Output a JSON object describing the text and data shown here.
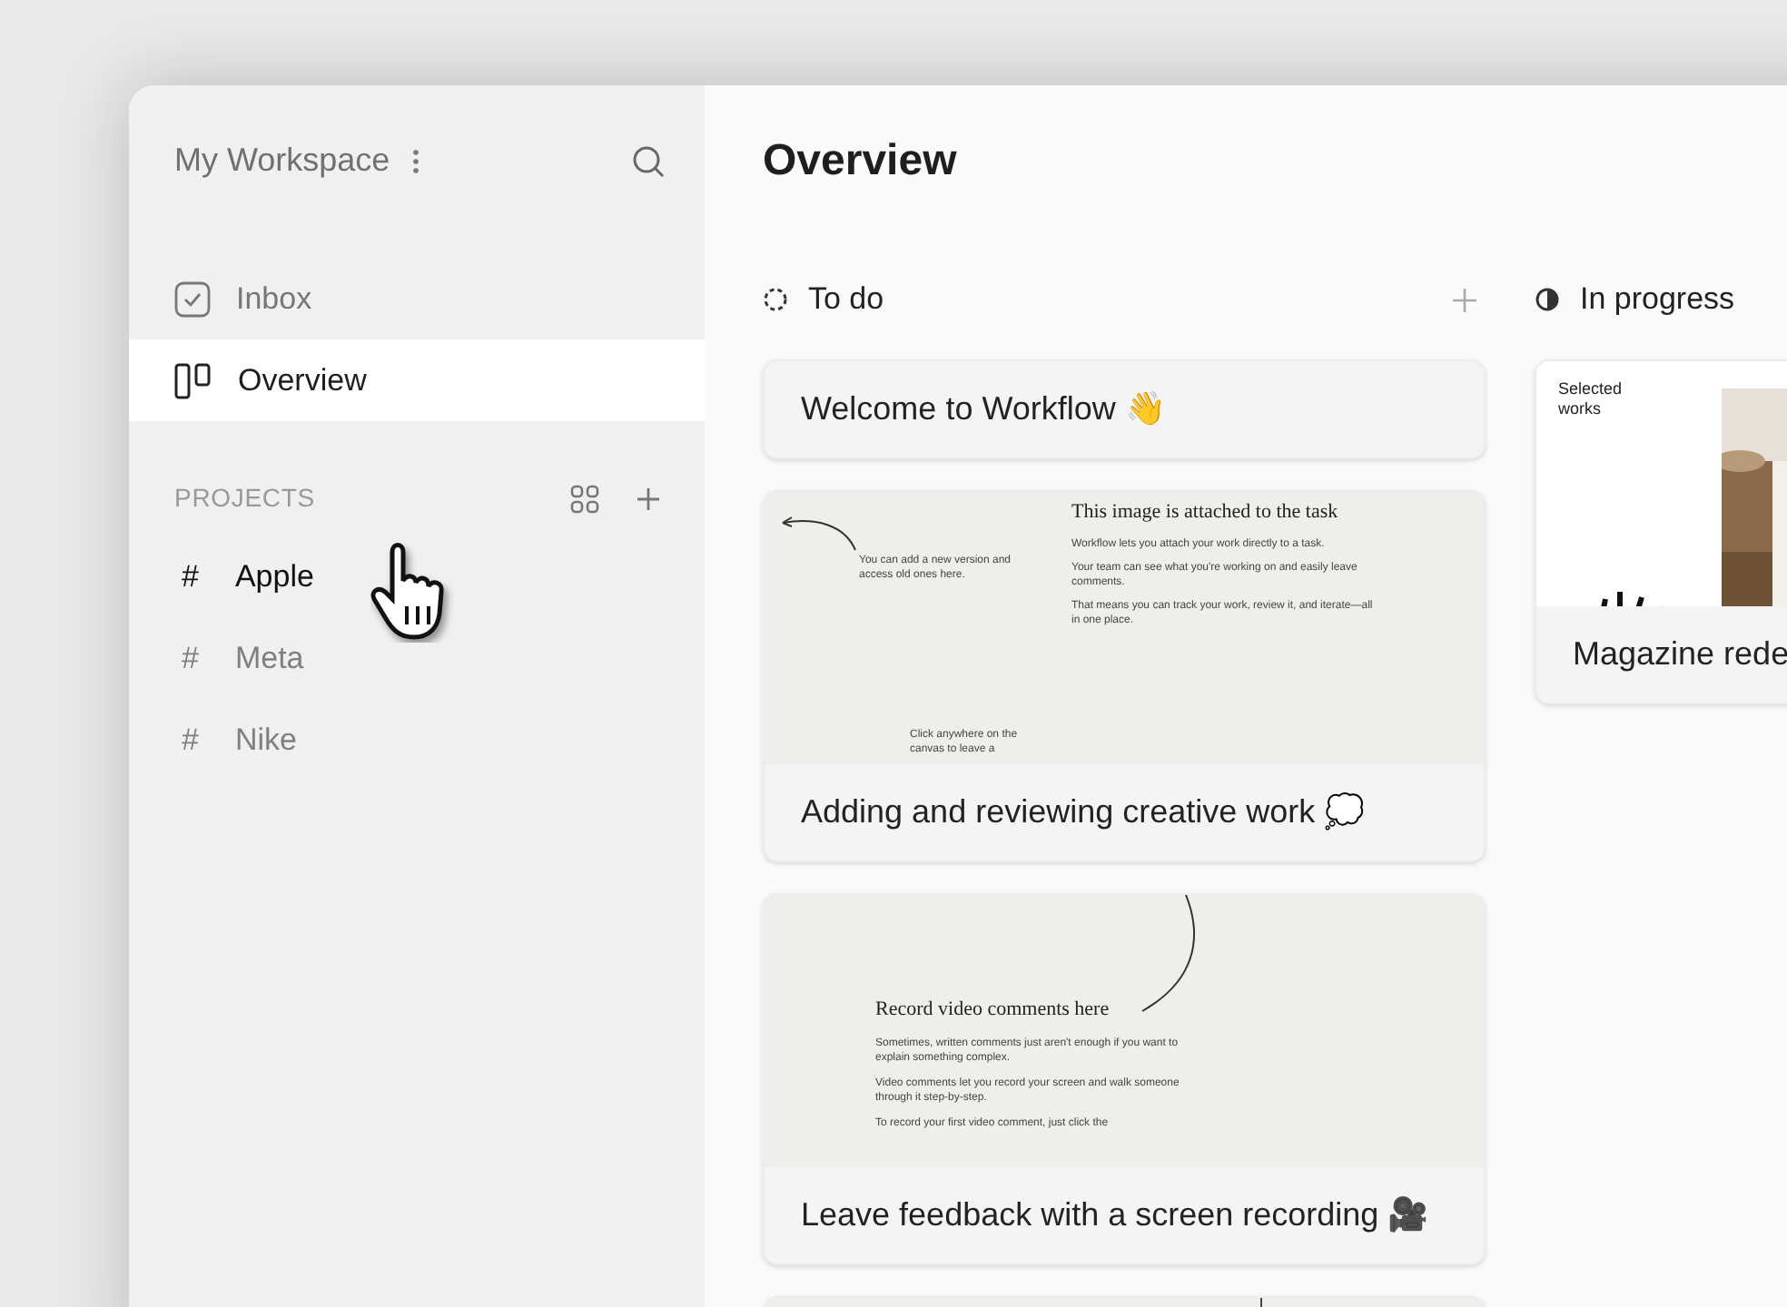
{
  "sidebar": {
    "workspace": "My Workspace",
    "nav": [
      {
        "label": "Inbox",
        "kind": "inbox",
        "selected": false
      },
      {
        "label": "Overview",
        "kind": "board",
        "selected": true
      }
    ],
    "projects_heading": "PROJECTS",
    "projects": [
      {
        "marker": "#",
        "label": "Apple",
        "hovered": true
      },
      {
        "marker": "#",
        "label": "Meta",
        "hovered": false
      },
      {
        "marker": "#",
        "label": "Nike",
        "hovered": false
      }
    ]
  },
  "main": {
    "title": "Overview",
    "columns": [
      {
        "title": "To do",
        "kind": "todo",
        "cards": [
          {
            "kind": "plain",
            "title": "Welcome to Workflow 👋"
          },
          {
            "kind": "attach_doc",
            "title": "Adding and reviewing creative work 💭",
            "preview": {
              "heading": "This image is attached to the task",
              "paragraphs": [
                "Workflow lets you attach your work directly to a task.",
                "Your team can see what you're working on and easily leave comments.",
                "That means you can track your work, review it, and iterate—all in one place."
              ],
              "notes": [
                "You can add a new version and access old ones here.",
                "Click anywhere on the canvas to leave a"
              ]
            }
          },
          {
            "kind": "video_doc",
            "title": "Leave feedback with a screen recording 🎥",
            "preview": {
              "heading": "Record video comments here",
              "paragraphs": [
                "Sometimes, written comments just aren't enough if you want to explain something complex.",
                "Video comments let you record your screen and walk someone through it step-by-step.",
                "To record your first video comment, just click the"
              ]
            }
          },
          {
            "kind": "image_only"
          }
        ]
      },
      {
        "title": "In progress",
        "kind": "progress",
        "cards": [
          {
            "kind": "magazine",
            "title": "Magazine rede",
            "preview": {
              "caption": "Selected works"
            }
          }
        ]
      }
    ]
  }
}
